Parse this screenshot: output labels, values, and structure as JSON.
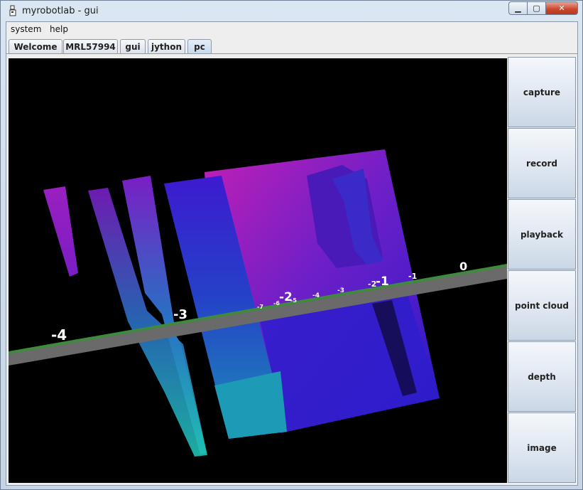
{
  "window": {
    "title": "myrobotlab - gui"
  },
  "menu": {
    "items": [
      "system",
      "help"
    ]
  },
  "tabs": [
    {
      "label": "Welcome",
      "active": false
    },
    {
      "label": "MRL57994",
      "active": false
    },
    {
      "label": "gui",
      "active": false
    },
    {
      "label": "jython",
      "active": false
    },
    {
      "label": "pc",
      "active": true
    }
  ],
  "buttons": {
    "capture": "capture",
    "record": "record",
    "playback": "playback",
    "point_cloud": "point cloud",
    "depth": "depth",
    "image": "image"
  },
  "axis_labels": {
    "n4": "-4",
    "n3": "-3",
    "n2": "-2",
    "n1": "-1",
    "z0": "0",
    "n2b": "-2",
    "n1b": "-1",
    "n7": "-7",
    "n6": "-6",
    "n5": "-5",
    "n4s": "-4",
    "n3s": "-3"
  },
  "colors": {
    "axis_bar": "#6a6a6a",
    "axis_edge": "#3f8a3f",
    "cloud_top": "#b51eb0",
    "cloud_mid": "#3a1ec6",
    "cloud_low": "#1fa3b2"
  }
}
